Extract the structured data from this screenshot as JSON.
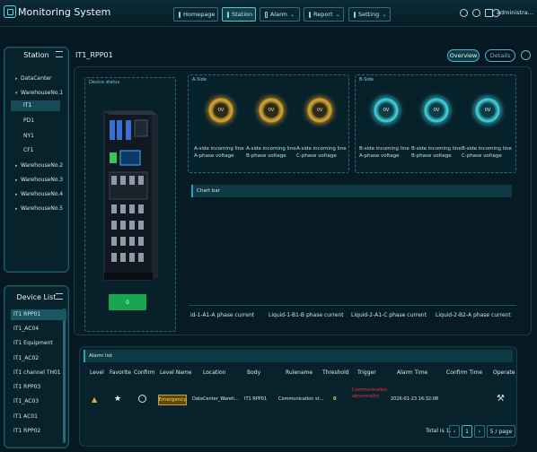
{
  "app": {
    "title": "Monitoring System",
    "user": "administra..."
  },
  "nav": [
    {
      "label": "Homepage",
      "caret": ""
    },
    {
      "label": "Station",
      "caret": ""
    },
    {
      "label": "Alarm",
      "caret": "⌄"
    },
    {
      "label": "Report",
      "caret": "⌄"
    },
    {
      "label": "Setting",
      "caret": "⌄"
    }
  ],
  "station_panel": {
    "title": "Station",
    "tree": [
      {
        "label": "DataCenter",
        "arrow": "▸"
      },
      {
        "label": "WarehouseNo.1",
        "arrow": "▾"
      },
      {
        "label": "IT1",
        "arrow": ""
      },
      {
        "label": "PD1",
        "arrow": ""
      },
      {
        "label": "NY1",
        "arrow": ""
      },
      {
        "label": "CF1",
        "arrow": ""
      },
      {
        "label": "WarehouseNo.2",
        "arrow": "▸"
      },
      {
        "label": "WarehouseNo.3",
        "arrow": "▸"
      },
      {
        "label": "WarehouseNo.4",
        "arrow": "▸"
      },
      {
        "label": "WarehouseNo.5",
        "arrow": "▸"
      }
    ]
  },
  "device_list": {
    "title": "Device List",
    "items": [
      "IT1 RPP01",
      "IT1_AC04",
      "IT1 Equipment",
      "IT1_AC02",
      "IT1 channel TH01",
      "IT1 RPP03",
      "IT1_AC03",
      "IT1 AC01",
      "IT1 RPP02"
    ]
  },
  "main": {
    "device_title": "IT1_RPP01",
    "tabs": [
      "Overview",
      "Details"
    ],
    "device_status_label": "Device status",
    "status_button": "0",
    "a_side": {
      "label": "A-Side",
      "gauges": [
        {
          "value": "0V",
          "label": "A-side incoming line A-phase voltage"
        },
        {
          "value": "0V",
          "label": "A-side incoming line B-phase voltage"
        },
        {
          "value": "0V",
          "label": "A-side incoming line C-phase voltage"
        }
      ]
    },
    "b_side": {
      "label": "B-Side",
      "gauges": [
        {
          "value": "0V",
          "label": "B-side incoming line A-phase voltage"
        },
        {
          "value": "0V",
          "label": "B-side incoming line B-phase voltage"
        },
        {
          "value": "0V",
          "label": "B-side incoming line C-phase voltage"
        }
      ]
    },
    "chart": {
      "title": "Chart bar",
      "categories": [
        "id-1-A1-A phase current",
        "Liquid-1-B1-B phase current",
        "Liquid-2-A1-C phase current",
        "Liquid-2-B2-A phase current"
      ]
    }
  },
  "alarm": {
    "title": "Alarm list",
    "columns": [
      "Level",
      "Favorite",
      "Confirm",
      "Level Name",
      "Location",
      "Body",
      "Rulename",
      "Threshold",
      "Trigger",
      "Alarm Time",
      "Confirm Time",
      "Operate"
    ],
    "rows": [
      {
        "level_name": "Emergency",
        "location": "DataCenter_Wareh...",
        "body": "IT1 RPP01",
        "rulename": "Communication st...",
        "threshold": "0",
        "trigger": "Communication abnormality",
        "alarm_time": "2026-01-23 16:32:08",
        "confirm_time": ""
      }
    ],
    "pager": {
      "total": "Total is 1.",
      "page": "1",
      "page_size": "5 / page"
    }
  },
  "colors": {
    "accent": "#4fc4d4",
    "emergency": "#c9a22a",
    "trigger": "#ff2f3a",
    "status_ok": "#19a552"
  }
}
